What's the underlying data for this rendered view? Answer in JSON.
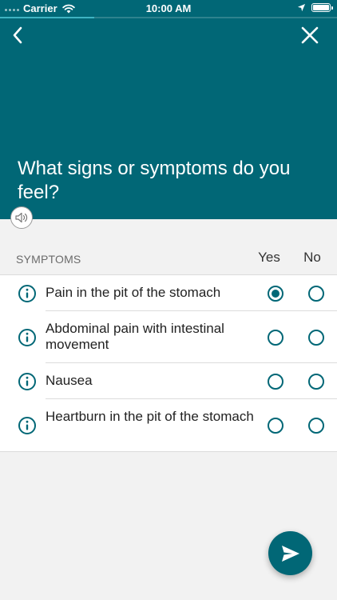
{
  "status_bar": {
    "carrier": "Carrier",
    "time": "10:00 AM"
  },
  "progress": {
    "fraction": 0.28
  },
  "header": {
    "back_icon": "chevron-left-icon",
    "close_icon": "close-icon",
    "title": "What signs or symptoms do you feel?",
    "audio_icon": "speaker-icon",
    "background_color": "#016776"
  },
  "table": {
    "column_symptoms": "SYMPTOMS",
    "column_yes": "Yes",
    "column_no": "No"
  },
  "symptoms": [
    {
      "label": "Pain in the pit of the stomach",
      "answer": "yes"
    },
    {
      "label": "Abdominal pain with intestinal movement",
      "answer": null
    },
    {
      "label": "Nausea",
      "answer": null
    },
    {
      "label": "Heartburn in the pit of the stomach",
      "answer": null
    }
  ],
  "send_button": {
    "icon": "send-icon"
  },
  "colors": {
    "accent": "#016776",
    "background": "#f2f2f2"
  }
}
